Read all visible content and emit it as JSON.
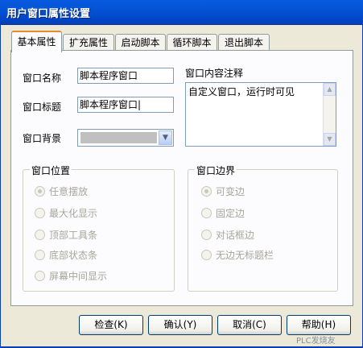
{
  "window": {
    "title": "用户窗口属性设置"
  },
  "tabs": [
    "基本属性",
    "扩充属性",
    "启动脚本",
    "循环脚本",
    "退出脚本"
  ],
  "form": {
    "name_label": "窗口名称",
    "name_value": "脚本程序窗口",
    "title_label": "窗口标题",
    "title_value": "脚本程序窗口|",
    "bg_label": "窗口背景",
    "bg_color": "#c0c0c0",
    "memo_label": "窗口内容注释",
    "memo_value": "自定义窗口，运行时可见"
  },
  "position_group": {
    "title": "窗口位置",
    "options": [
      "任意摆放",
      "最大化显示",
      "顶部工具条",
      "底部状态条",
      "屏幕中间显示"
    ],
    "selected": "任意摆放"
  },
  "border_group": {
    "title": "窗口边界",
    "options": [
      "可变边",
      "固定边",
      "对话框边",
      "无边无标题栏"
    ],
    "selected": "可变边"
  },
  "buttons": {
    "check": "检查(K)",
    "ok": "确认(Y)",
    "cancel": "取消(C)",
    "help": "帮助(H)"
  },
  "watermark": "PLC发烧友",
  "colors": {
    "title_bar": "#0454d6",
    "tab_highlight": "#e68b2c",
    "dialog_bg": "#ece9d8"
  }
}
